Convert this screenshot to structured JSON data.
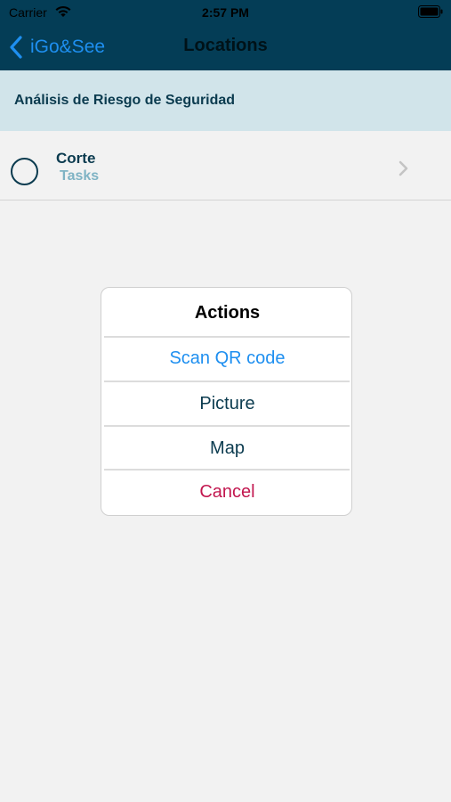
{
  "status_bar": {
    "carrier": "Carrier",
    "time": "2:57 PM"
  },
  "nav": {
    "back_label": "iGo&See",
    "title": "Locations"
  },
  "section": {
    "title": "Análisis de Riesgo de Seguridad"
  },
  "list": {
    "items": [
      {
        "title": "Corte",
        "subtitle": "Tasks"
      }
    ]
  },
  "action_sheet": {
    "title": "Actions",
    "actions": [
      {
        "label": "Scan QR code"
      },
      {
        "label": "Picture"
      },
      {
        "label": "Map"
      },
      {
        "label": "Cancel"
      }
    ]
  },
  "colors": {
    "nav_background": "#043d56",
    "section_background": "#d1e4ea",
    "accent_blue": "#1e8ff0",
    "cancel_red": "#c2174f",
    "text_dark": "#0b3b4f",
    "subtitle_teal": "#7fb3c4"
  },
  "icons": [
    "wifi-icon",
    "battery-icon",
    "back-chevron-icon",
    "radio-circle-icon",
    "chevron-right-icon"
  ]
}
